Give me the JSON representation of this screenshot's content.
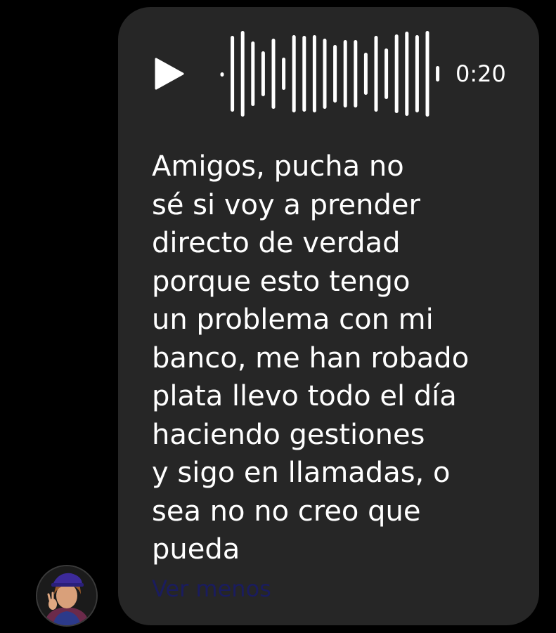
{
  "message": {
    "audio": {
      "duration": "0:20",
      "play_icon": "play-icon",
      "waveform_icon": "audio-waveform"
    },
    "transcript_lines": [
      "Amigos, pucha no",
      "sé si voy a prender",
      "directo de verdad",
      "porque esto tengo",
      "un problema con mi",
      "banco, me han robado",
      "plata llevo todo el día",
      "haciendo gestiones",
      "y sigo en llamadas, o",
      "sea no no creo que",
      "pueda"
    ],
    "see_less_label": "Ver menos"
  },
  "sender": {
    "avatar_icon": "user-avatar"
  },
  "colors": {
    "background": "#000000",
    "bubble": "#262626",
    "text": "#ffffff",
    "link": "#1a1c5e"
  }
}
